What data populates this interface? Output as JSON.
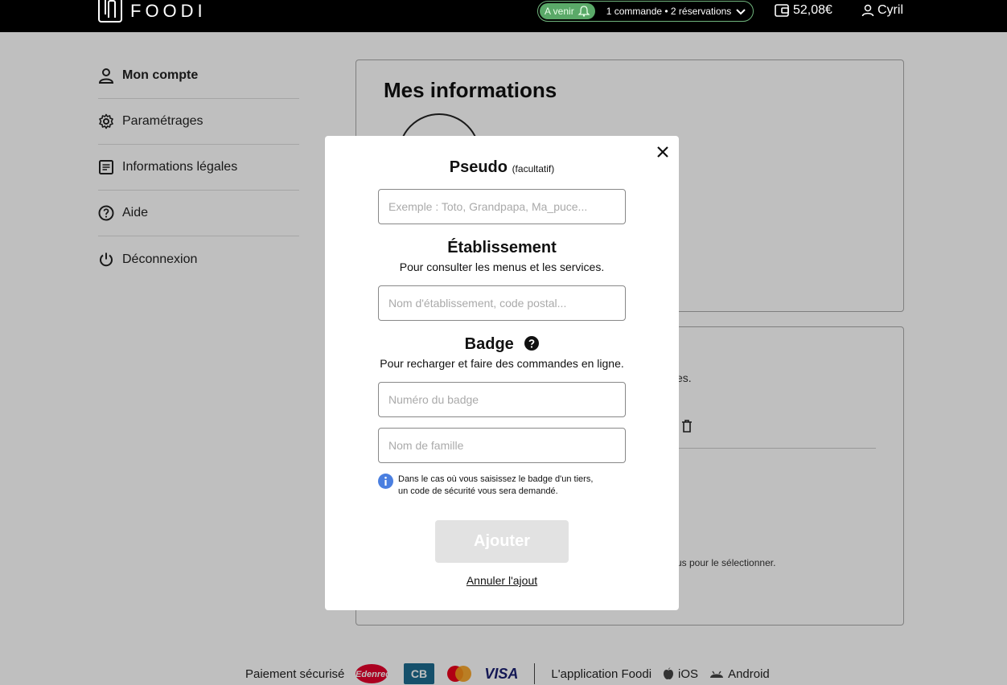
{
  "header": {
    "logo_text": "FOODI",
    "upcoming_label": "A venir",
    "upcoming_summary": "1 commande • 2 réservations",
    "wallet_balance": "52,08€",
    "user_name": "Cyril"
  },
  "sidebar": {
    "items": [
      {
        "label": "Mon compte",
        "icon": "user-icon"
      },
      {
        "label": "Paramétrages",
        "icon": "gear-icon"
      },
      {
        "label": "Informations légales",
        "icon": "document-icon"
      },
      {
        "label": "Aide",
        "icon": "help-icon"
      },
      {
        "label": "Déconnexion",
        "icon": "power-icon"
      }
    ]
  },
  "main": {
    "card1_title": "Mes informations",
    "bg_text1": "es.",
    "bg_text2": "us pour le sélectionner."
  },
  "modal": {
    "pseudo_title": "Pseudo",
    "pseudo_optional": "(facultatif)",
    "pseudo_placeholder": "Exemple : Toto, Grandpapa, Ma_puce...",
    "etab_title": "Établissement",
    "etab_sub": "Pour consulter les menus et les services.",
    "etab_placeholder": "Nom d'établissement, code postal...",
    "badge_title": "Badge",
    "badge_sub": "Pour recharger et faire des commandes en ligne.",
    "badge_number_placeholder": "Numéro du badge",
    "last_name_placeholder": "Nom de famille",
    "info_line1": "Dans le cas où vous saisissez le badge d'un tiers,",
    "info_line2": "un code de sécurité vous sera demandé.",
    "add_label": "Ajouter",
    "cancel_label": "Annuler l'ajout"
  },
  "footer": {
    "secure_payment": "Paiement sécurisé",
    "edenred": "Edenred",
    "cb": "CB",
    "visa": "VISA",
    "app_label": "L'application Foodi",
    "ios": "iOS",
    "android": "Android"
  },
  "colors": {
    "accent_green": "#5aa968",
    "info_blue": "#4a7fe0",
    "mastercard_red": "#eb001b",
    "mastercard_orange": "#f79e1b",
    "visa_blue": "#1a1f71",
    "cb_blue": "#1d6b8f",
    "edenred_red": "#e4002b"
  }
}
